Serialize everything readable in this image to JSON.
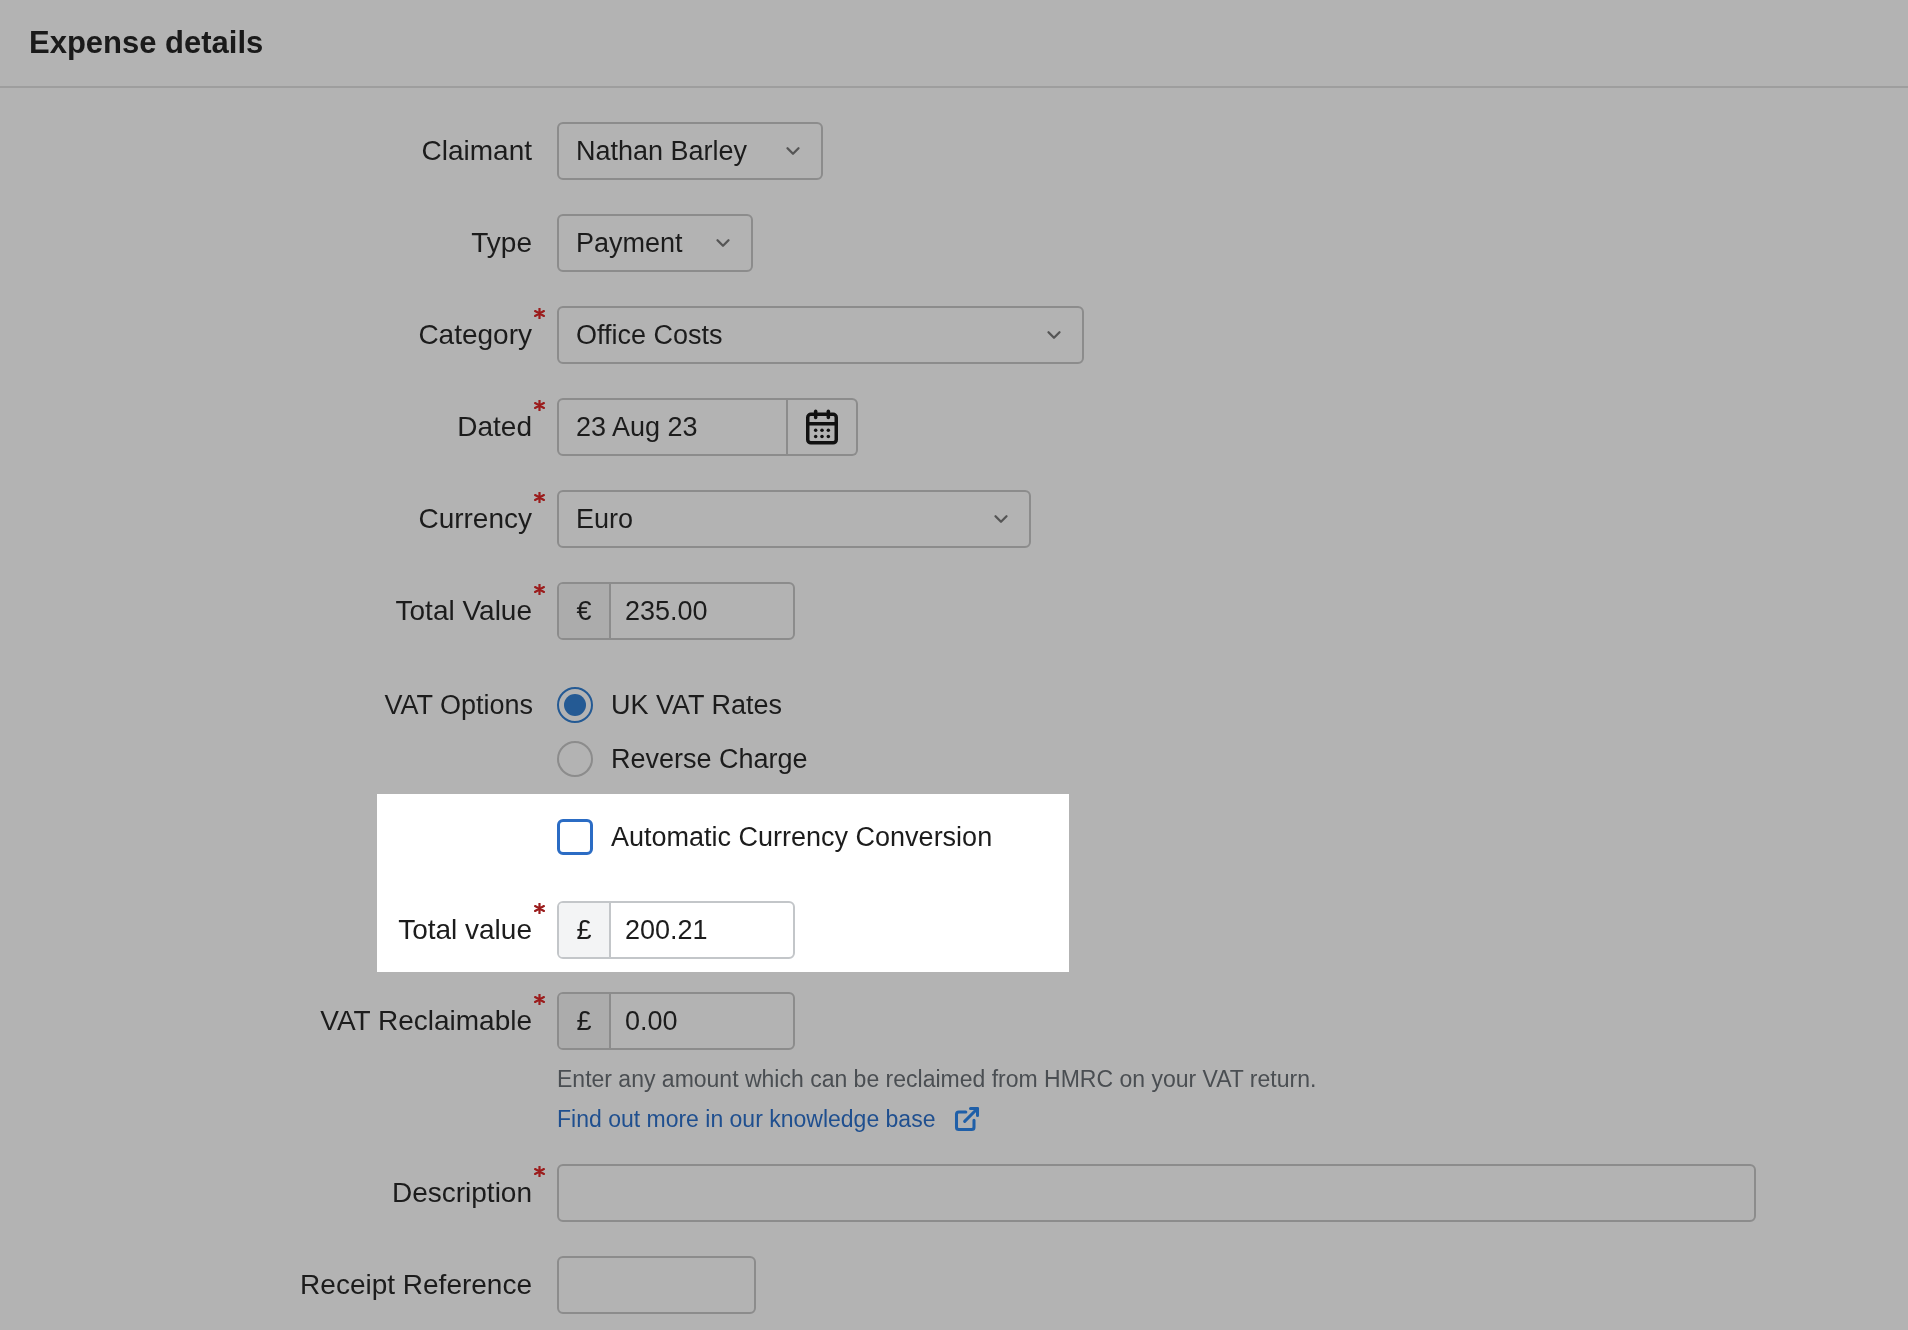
{
  "header": {
    "title": "Expense details"
  },
  "claimant": {
    "label": "Claimant",
    "required": false,
    "value": "Nathan Barley"
  },
  "type": {
    "label": "Type",
    "required": false,
    "value": "Payment"
  },
  "category": {
    "label": "Category",
    "required": true,
    "value": "Office Costs"
  },
  "dated": {
    "label": "Dated",
    "required": true,
    "value": "23 Aug 23"
  },
  "currency": {
    "label": "Currency",
    "required": true,
    "value": "Euro"
  },
  "total_value": {
    "label": "Total Value",
    "required": true,
    "symbol": "€",
    "value": "235.00"
  },
  "vat_options": {
    "label": "VAT Options",
    "options": [
      {
        "label": "UK VAT Rates",
        "selected": true
      },
      {
        "label": "Reverse Charge",
        "selected": false
      }
    ]
  },
  "conversion": {
    "checkbox": {
      "label": "Automatic Currency Conversion",
      "checked": false
    },
    "total_value": {
      "label": "Total value",
      "required": true,
      "symbol": "£",
      "value": "200.21"
    }
  },
  "vat_reclaimable": {
    "label": "VAT Reclaimable",
    "required": true,
    "symbol": "£",
    "value": "0.00",
    "help": "Enter any amount which can be reclaimed from HMRC on your VAT return.",
    "link": "Find out more in our knowledge base"
  },
  "description": {
    "label": "Description",
    "required": true
  },
  "receipt_reference": {
    "label": "Receipt Reference",
    "required": false
  }
}
